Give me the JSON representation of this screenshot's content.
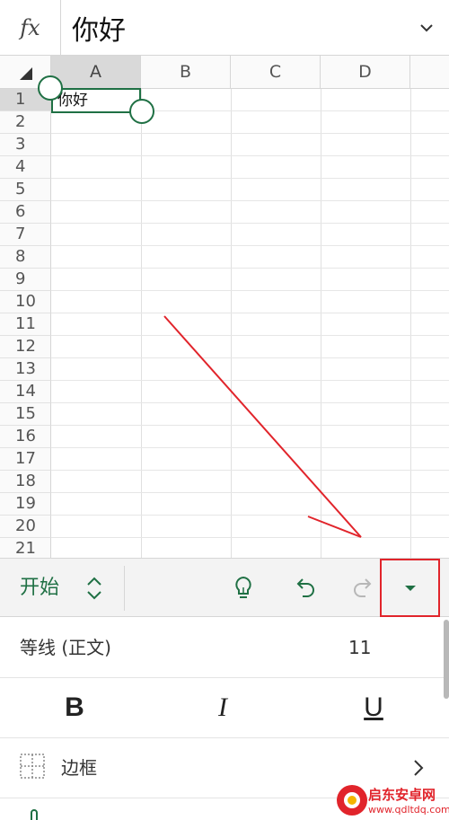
{
  "formula_bar": {
    "fx_label": "fx",
    "content": "你好"
  },
  "sheet": {
    "columns": [
      "A",
      "B",
      "C",
      "D"
    ],
    "selected_column": "A",
    "rows": [
      "1",
      "2",
      "3",
      "4",
      "5",
      "6",
      "7",
      "8",
      "9",
      "10",
      "11",
      "12",
      "13",
      "14",
      "15",
      "16",
      "17",
      "18",
      "19",
      "20",
      "21"
    ],
    "selected_row": "1",
    "cell_a1": "你好"
  },
  "toolbar": {
    "tab_label": "开始",
    "icons": [
      "tab-switch-icon",
      "lightbulb-icon",
      "undo-icon",
      "redo-icon",
      "dropdown-caret-icon"
    ]
  },
  "panel": {
    "font_name": "等线 (正文)",
    "font_size": "11",
    "bold": "B",
    "italic": "I",
    "underline": "U",
    "border_label": "边框"
  },
  "watermark": {
    "name": "启东安卓网",
    "url": "www.qdltdq.com"
  },
  "colors": {
    "accent_green": "#1f7044",
    "annotation_red": "#e1242b",
    "toolbar_bg": "#f3f3f3"
  }
}
